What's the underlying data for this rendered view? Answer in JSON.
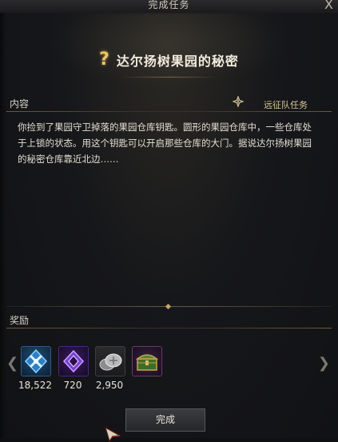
{
  "window": {
    "title": "完成任务",
    "close_glyph": "X"
  },
  "quest": {
    "marker": "?",
    "title": "达尔扬树果园的秘密",
    "category": "远征队任务",
    "content_label": "内容",
    "description": "你捡到了果园守卫掉落的果园仓库钥匙。圆形的果园仓库中，一些仓库处于上锁的状态。用这个钥匙可以开启那些仓库的大门。据说达尔扬树果园的秘密仓库靠近北边……"
  },
  "rewards": {
    "label": "奖励",
    "items": [
      {
        "icon": "blue-crystal-icon",
        "count": "18,522"
      },
      {
        "icon": "purple-gem-icon",
        "count": "720"
      },
      {
        "icon": "silver-coins-icon",
        "count": "2,950"
      },
      {
        "icon": "treasure-chest-icon",
        "count": ""
      }
    ],
    "prev_glyph": "❮",
    "next_glyph": "❯"
  },
  "actions": {
    "complete_label": "完成"
  },
  "colors": {
    "gold_accent": "#c7a868",
    "blue_reward": "#4aa3e0",
    "purple_reward": "#8a4fd6"
  }
}
